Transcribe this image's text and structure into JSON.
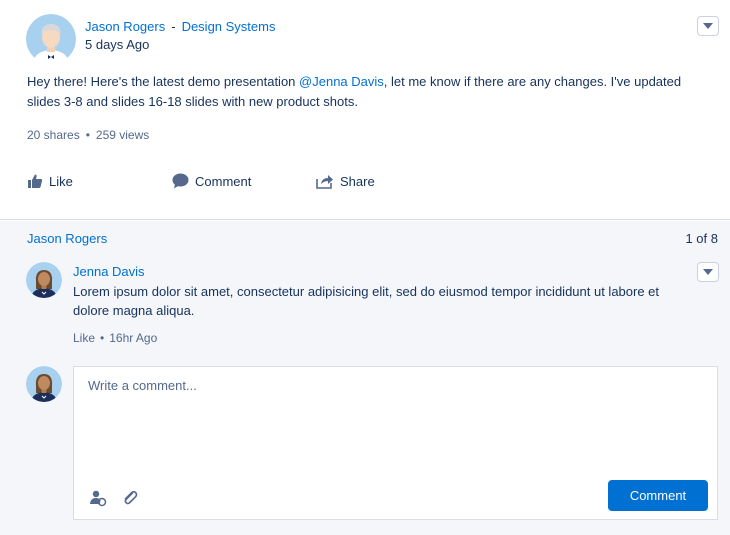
{
  "post": {
    "author": "Jason Rogers",
    "separator": "-",
    "group": "Design Systems",
    "time": "5 days Ago",
    "body_before": "Hey there! Here's the latest demo presentation ",
    "mention": "@Jenna Davis",
    "body_after": ", let me know if there are any changes. I've updated slides 3-8 and slides 16-18 slides with new product shots.",
    "shares": "20 shares",
    "stat_sep": "•",
    "views": "259 views",
    "actions": {
      "like": "Like",
      "comment": "Comment",
      "share": "Share"
    }
  },
  "thread": {
    "title": "Jason Rogers",
    "pager": "1 of 8",
    "comment": {
      "author": "Jenna Davis",
      "text": "Lorem ipsum dolor sit amet, consectetur adipisicing elit, sed do eiusmod tempor incididunt ut labore et dolore magna aliqua.",
      "like": "Like",
      "sep": "•",
      "time": "16hr Ago"
    },
    "composer": {
      "placeholder": "Write a comment...",
      "submit": "Comment"
    }
  },
  "colors": {
    "link": "#0070d2",
    "text": "#16325c",
    "muted": "#54698d",
    "thread_bg": "#f4f6f9",
    "button": "#0070d2"
  },
  "icons": [
    "caret-down-icon",
    "like-icon",
    "comment-icon",
    "share-icon",
    "mention-icon",
    "attach-icon"
  ]
}
